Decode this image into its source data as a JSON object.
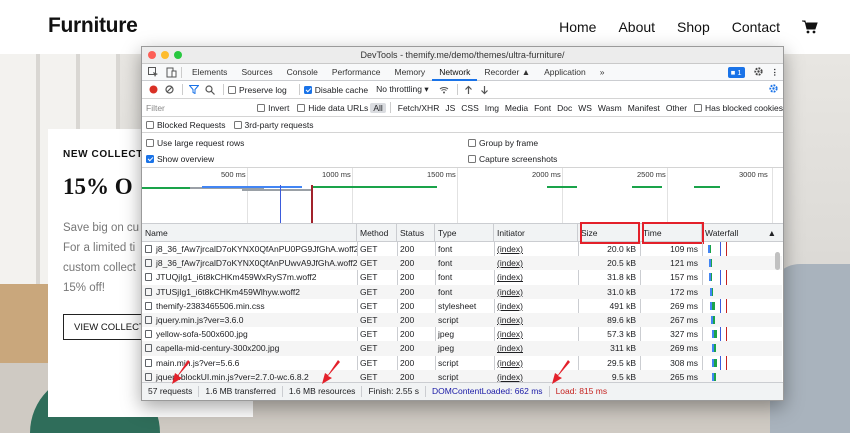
{
  "site": {
    "logo": "Furniture",
    "nav": [
      "Home",
      "About",
      "Shop",
      "Contact"
    ],
    "hero": {
      "kicker": "NEW COLLECTI",
      "title": "15% O",
      "text": "Save big on cu\nFor a limited ti\ncustom collect\n15% off!",
      "button": "VIEW COLLECTI"
    }
  },
  "devtools": {
    "window_title": "DevTools - themify.me/demo/themes/ultra-furniture/",
    "tabs": [
      "Elements",
      "Sources",
      "Console",
      "Performance",
      "Memory",
      "Network",
      "Recorder",
      "Application"
    ],
    "active_tab": "Network",
    "issues_count": "1",
    "toolbar": {
      "preserve_log": "Preserve log",
      "disable_cache": "Disable cache",
      "throttling": "No throttling"
    },
    "filter": {
      "placeholder": "Filter",
      "invert": "Invert",
      "hide_data_urls": "Hide data URLs",
      "types": [
        "All",
        "Fetch/XHR",
        "JS",
        "CSS",
        "Img",
        "Media",
        "Font",
        "Doc",
        "WS",
        "Wasm",
        "Manifest",
        "Other"
      ],
      "has_blocked_cookies": "Has blocked cookies",
      "blocked_requests": "Blocked Requests",
      "third_party": "3rd-party requests"
    },
    "options": {
      "large_rows": "Use large request rows",
      "group_by_frame": "Group by frame",
      "show_overview": "Show overview",
      "capture_screenshots": "Capture screenshots"
    },
    "overview_ticks": [
      "500 ms",
      "1000 ms",
      "1500 ms",
      "2000 ms",
      "2500 ms",
      "3000 ms"
    ],
    "columns": [
      "Name",
      "Method",
      "Status",
      "Type",
      "Initiator",
      "Size",
      "Time",
      "Waterfall"
    ],
    "rows": [
      {
        "name": "j8_36_fAw7jrcalD7oKYNX0QfAnPU0PG9JfGhA.woff2",
        "method": "GET",
        "status": "200",
        "type": "font",
        "initiator": "(index)",
        "size": "20.0 kB",
        "time": "109 ms"
      },
      {
        "name": "j8_36_fAw7jrcalD7oKYNX0QfAnPUwvA9JfGhA.woff2",
        "method": "GET",
        "status": "200",
        "type": "font",
        "initiator": "(index)",
        "size": "20.5 kB",
        "time": "121 ms"
      },
      {
        "name": "JTUQjIg1_i6t8kCHKm459WxRyS7m.woff2",
        "method": "GET",
        "status": "200",
        "type": "font",
        "initiator": "(index)",
        "size": "31.8 kB",
        "time": "157 ms"
      },
      {
        "name": "JTUSjIg1_i6t8kCHKm459Wlhyw.woff2",
        "method": "GET",
        "status": "200",
        "type": "font",
        "initiator": "(index)",
        "size": "31.0 kB",
        "time": "172 ms"
      },
      {
        "name": "themify-2383465506.min.css",
        "method": "GET",
        "status": "200",
        "type": "stylesheet",
        "initiator": "(index)",
        "size": "491 kB",
        "time": "269 ms"
      },
      {
        "name": "jquery.min.js?ver=3.6.0",
        "method": "GET",
        "status": "200",
        "type": "script",
        "initiator": "(index)",
        "size": "89.6 kB",
        "time": "267 ms"
      },
      {
        "name": "yellow-sofa-500x600.jpg",
        "method": "GET",
        "status": "200",
        "type": "jpeg",
        "initiator": "(index)",
        "size": "57.3 kB",
        "time": "327 ms"
      },
      {
        "name": "capella-mid-century-300x200.jpg",
        "method": "GET",
        "status": "200",
        "type": "jpeg",
        "initiator": "(index)",
        "size": "311 kB",
        "time": "269 ms"
      },
      {
        "name": "main.min.js?ver=5.6.6",
        "method": "GET",
        "status": "200",
        "type": "script",
        "initiator": "(index)",
        "size": "29.5 kB",
        "time": "308 ms"
      },
      {
        "name": "jquery.blockUI.min.js?ver=2.7.0-wc.6.8.2",
        "method": "GET",
        "status": "200",
        "type": "script",
        "initiator": "(index)",
        "size": "9.5 kB",
        "time": "265 ms"
      }
    ],
    "status": {
      "requests": "57 requests",
      "transferred": "1.6 MB transferred",
      "resources": "1.6 MB resources",
      "finish": "Finish: 2.55 s",
      "dcl": "DOMContentLoaded: 662 ms",
      "load": "Load: 815 ms"
    },
    "colors": {
      "accent": "#1a73e8",
      "annotation_red": "#e3202a",
      "dcl_blue": "#1a1aa6",
      "load_red": "#c5221f"
    }
  }
}
